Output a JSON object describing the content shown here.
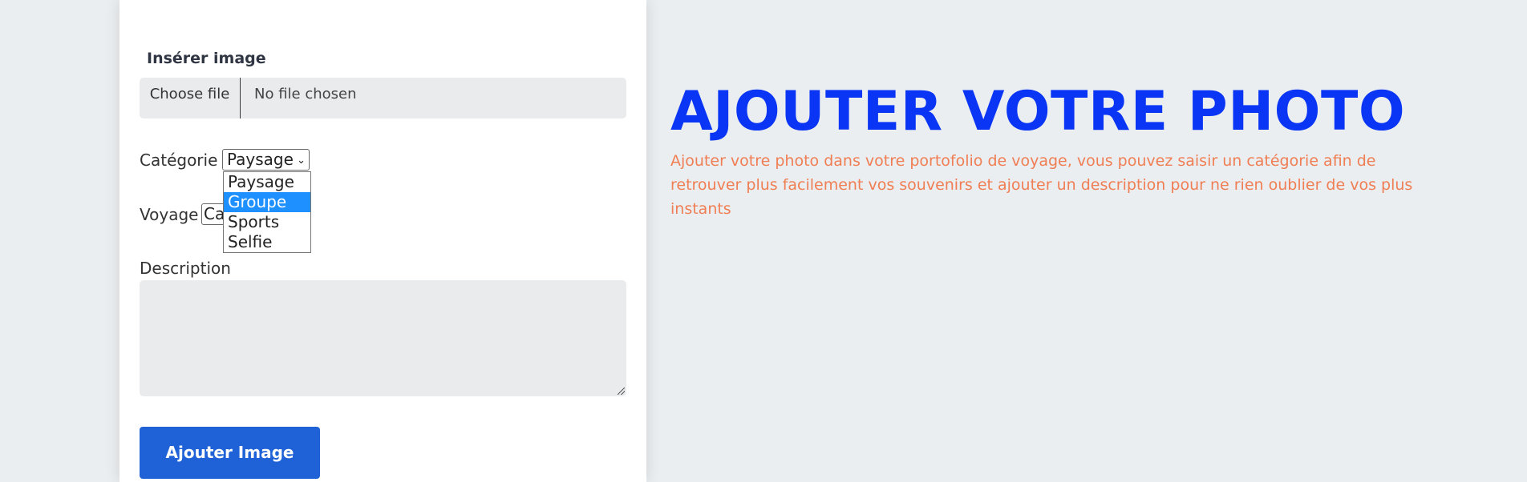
{
  "form": {
    "file_label": "Insérer image",
    "file_button": "Choose file",
    "file_status": "No file chosen",
    "category_label": "Catégorie",
    "category_selected": "Paysage",
    "category_options": [
      "Paysage",
      "Groupe",
      "Sports",
      "Selfie"
    ],
    "category_highlighted": "Groupe",
    "voyage_label": "Voyage",
    "voyage_selected_visible": "Ca",
    "description_label": "Description",
    "description_value": "",
    "submit_label": "Ajouter Image"
  },
  "hero": {
    "title": "AJOUTER VOTRE PHOTO",
    "text": "Ajouter votre photo dans votre portofolio de voyage, vous pouvez saisir un catégorie afin de retrouver plus facilement vos souvenirs et ajouter un description pour ne rien oublier de vos plus instants"
  },
  "colors": {
    "title": "#0a35f5",
    "text": "#f07e54",
    "button": "#1f61d6",
    "highlight": "#1e90ff"
  },
  "icons": {
    "select_chevron": "chevron-down-icon",
    "resize_handle": "resize-handle-icon"
  }
}
